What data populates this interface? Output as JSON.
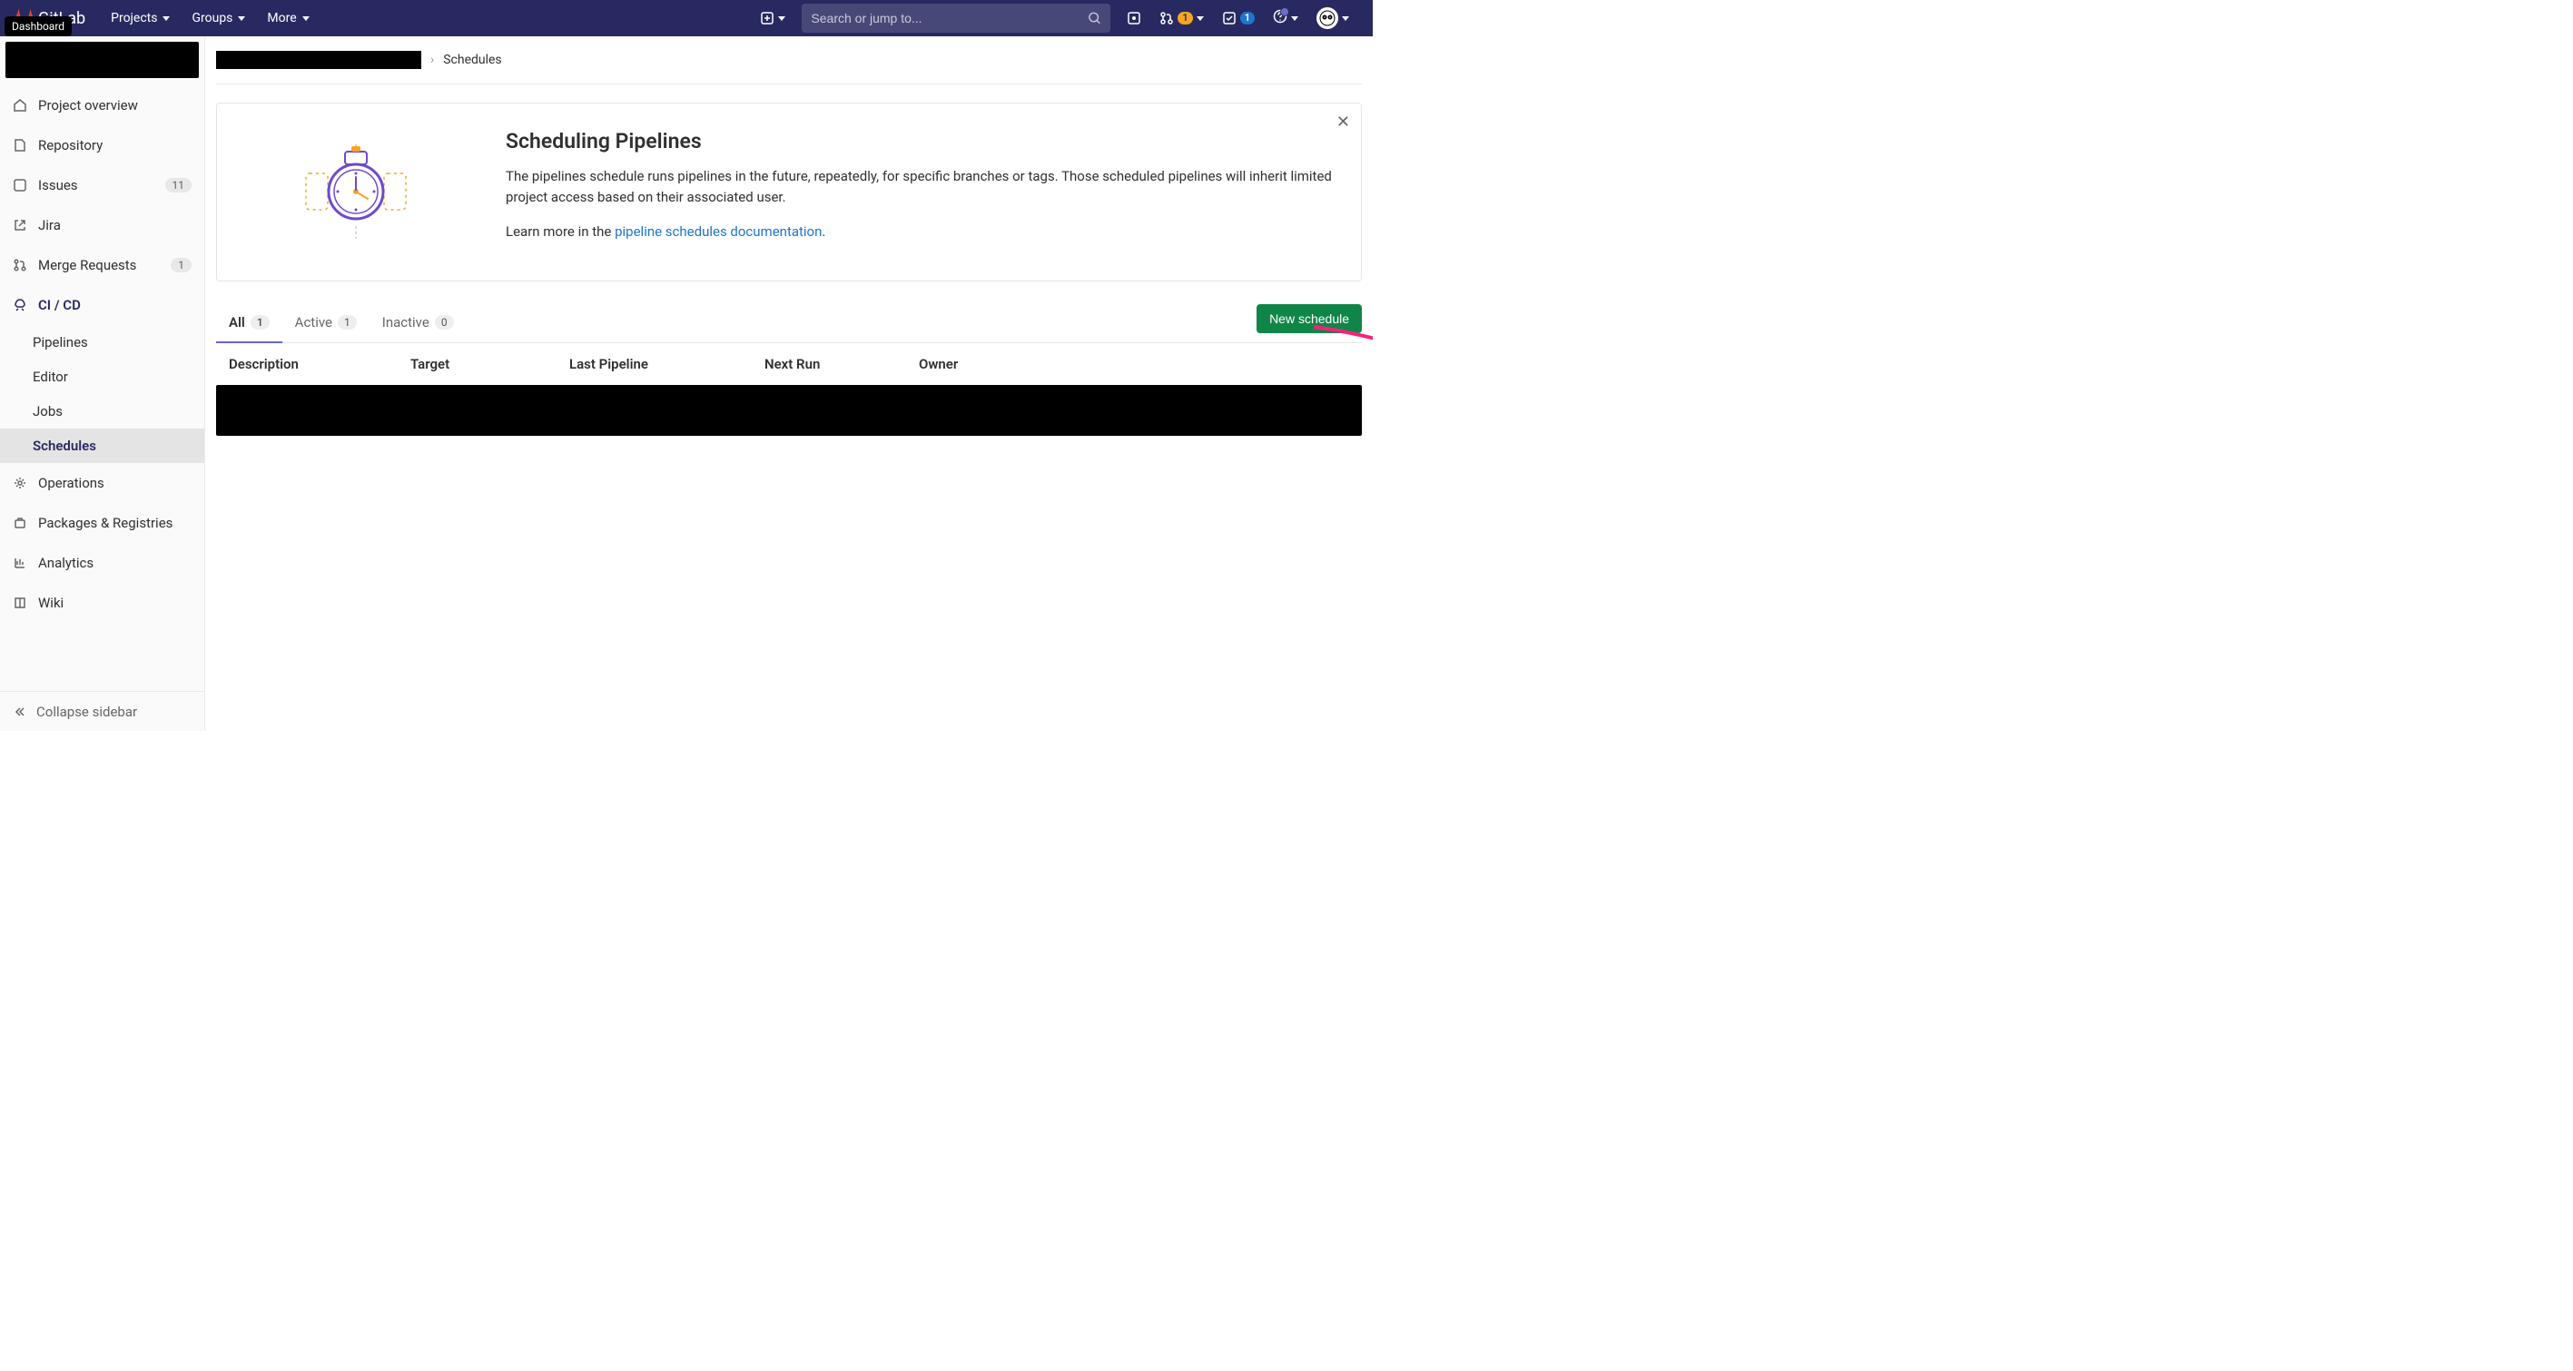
{
  "topnav": {
    "brand": "GitLab",
    "menus": [
      {
        "label": "Projects"
      },
      {
        "label": "Groups"
      },
      {
        "label": "More"
      }
    ],
    "search_placeholder": "Search or jump to...",
    "merge_badge": "1",
    "todo_badge": "1",
    "tooltip": "Dashboard"
  },
  "sidebar": {
    "items": [
      {
        "label": "Project overview"
      },
      {
        "label": "Repository"
      },
      {
        "label": "Issues",
        "count": "11"
      },
      {
        "label": "Jira"
      },
      {
        "label": "Merge Requests",
        "count": "1"
      },
      {
        "label": "CI / CD",
        "active": true
      },
      {
        "label": "Operations"
      },
      {
        "label": "Packages & Registries"
      },
      {
        "label": "Analytics"
      },
      {
        "label": "Wiki"
      }
    ],
    "cicd_sub": [
      {
        "label": "Pipelines"
      },
      {
        "label": "Editor"
      },
      {
        "label": "Jobs"
      },
      {
        "label": "Schedules",
        "active": true
      }
    ],
    "collapse": "Collapse sidebar"
  },
  "breadcrumbs": {
    "current": "Schedules"
  },
  "info": {
    "title": "Scheduling Pipelines",
    "body": "The pipelines schedule runs pipelines in the future, repeatedly, for specific branches or tags. Those scheduled pipelines will inherit limited project access based on their associated user.",
    "learn_prefix": "Learn more in the ",
    "learn_link": "pipeline schedules documentation",
    "learn_suffix": "."
  },
  "tabs": [
    {
      "label": "All",
      "count": "1",
      "active": true
    },
    {
      "label": "Active",
      "count": "1"
    },
    {
      "label": "Inactive",
      "count": "0"
    }
  ],
  "new_button": "New schedule",
  "columns": {
    "description": "Description",
    "target": "Target",
    "last": "Last Pipeline",
    "next": "Next Run",
    "owner": "Owner"
  }
}
